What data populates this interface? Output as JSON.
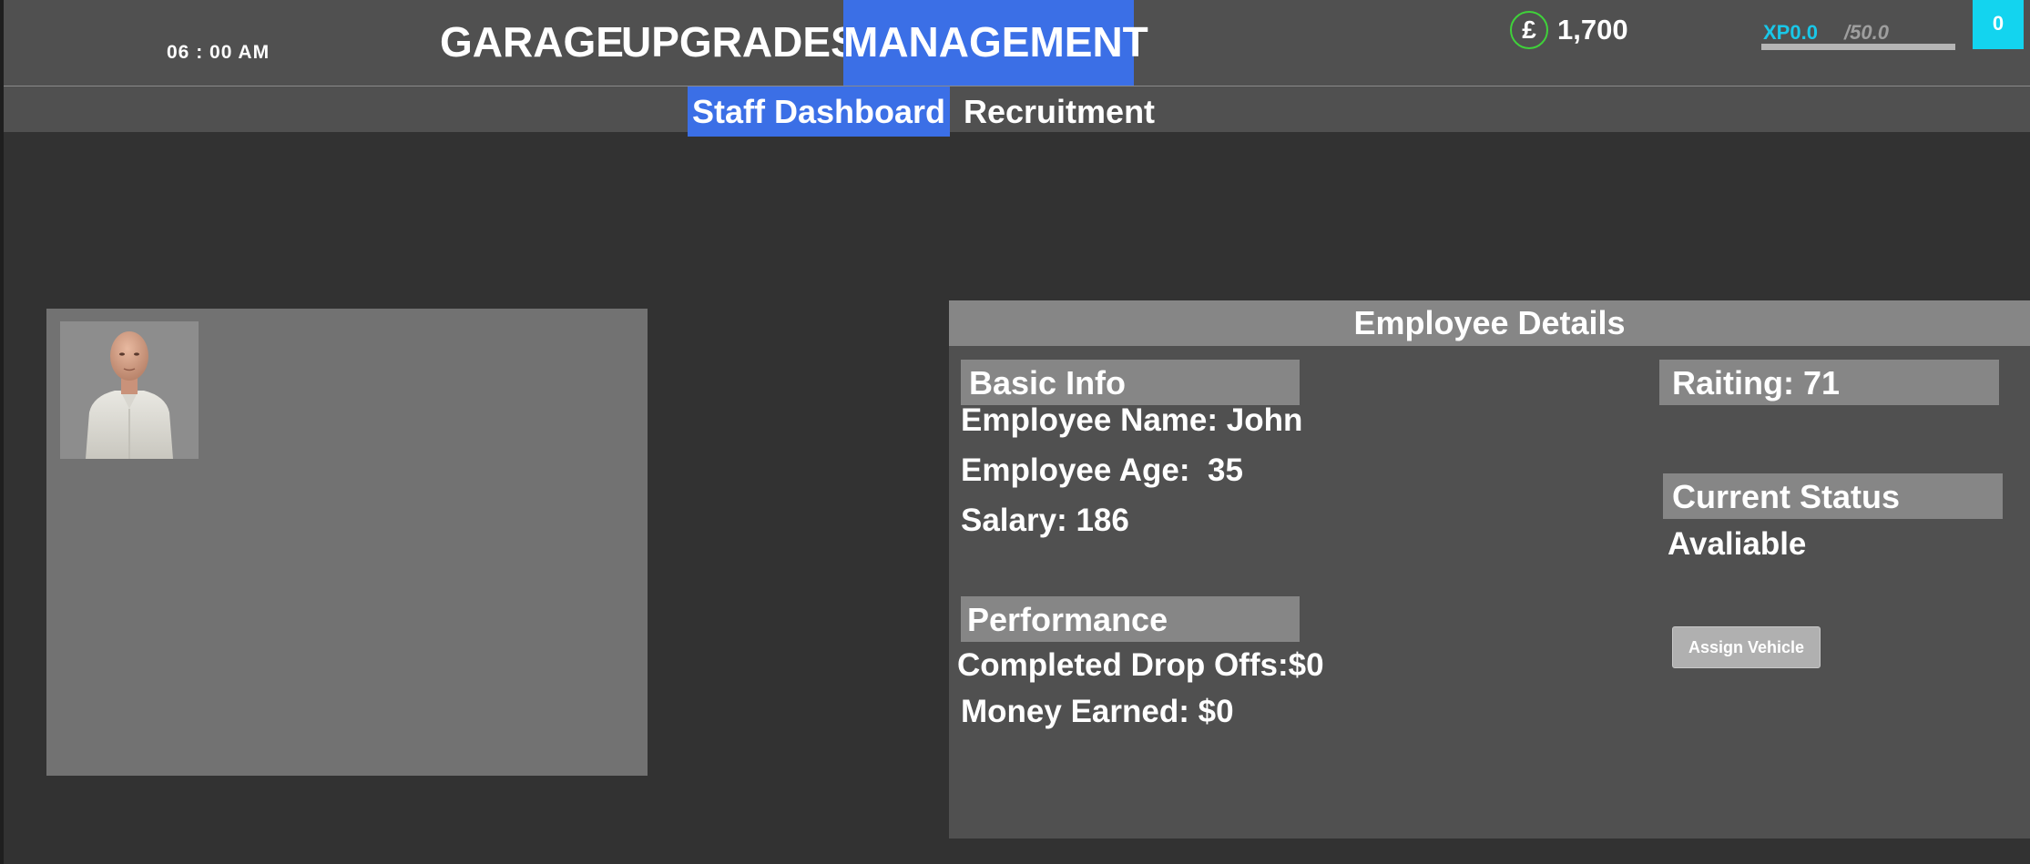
{
  "header": {
    "clock": "06 : 00 AM",
    "tabs": [
      {
        "label": "GARAGE"
      },
      {
        "label": "UPGRADES"
      },
      {
        "label": "MANAGEMENT",
        "active": true
      }
    ],
    "currency": {
      "symbol": "£",
      "amount": "1,700",
      "ring_color": "#3fd23a"
    },
    "xp": {
      "current_label": "XP0.0",
      "max_label": "/50.0",
      "progress": 0.0,
      "color": "#19c7e8"
    },
    "level": "0"
  },
  "subtabs": [
    {
      "label": "Staff Dashboard",
      "active": true
    },
    {
      "label": "Recruitment"
    }
  ],
  "employee_card": {
    "portrait": "employee-portrait"
  },
  "details": {
    "title": "Employee Details",
    "basic_info": {
      "title": "Basic Info",
      "name": "Employee Name: John",
      "age": "Employee Age:  35",
      "salary": "Salary: 186"
    },
    "performance": {
      "title": "Performance",
      "drop_offs": "Completed Drop Offs:$0",
      "money_earned": "Money Earned: $0"
    },
    "rating": "Raiting:  71",
    "status": {
      "title": "Current Status",
      "value": "Avaliable"
    },
    "assign_button": "Assign Vehicle"
  },
  "theme": {
    "accent": "#3b6fe6",
    "level_color": "#13d4ef"
  }
}
